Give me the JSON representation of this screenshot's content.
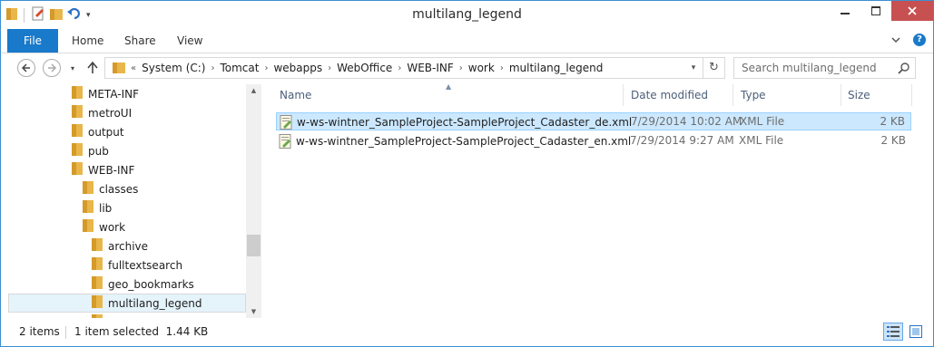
{
  "window": {
    "title": "multilang_legend"
  },
  "ribbon": {
    "tabs": [
      {
        "label": "File"
      },
      {
        "label": "Home"
      },
      {
        "label": "Share"
      },
      {
        "label": "View"
      }
    ]
  },
  "address": {
    "overflow": "«",
    "crumbs": [
      "System (C:)",
      "Tomcat",
      "webapps",
      "WebOffice",
      "WEB-INF",
      "work",
      "multilang_legend"
    ]
  },
  "search": {
    "placeholder": "Search multilang_legend"
  },
  "navpane": {
    "items": [
      {
        "label": "META-INF"
      },
      {
        "label": "metroUI"
      },
      {
        "label": "output"
      },
      {
        "label": "pub"
      },
      {
        "label": "WEB-INF"
      },
      {
        "label": "classes"
      },
      {
        "label": "lib"
      },
      {
        "label": "work"
      },
      {
        "label": "archive"
      },
      {
        "label": "fulltextsearch"
      },
      {
        "label": "geo_bookmarks"
      },
      {
        "label": "multilang_legend"
      }
    ]
  },
  "filelist": {
    "columns": {
      "name": "Name",
      "date": "Date modified",
      "type": "Type",
      "size": "Size"
    },
    "rows": [
      {
        "name": "w-ws-wintner_SampleProject-SampleProject_Cadaster_de.xml",
        "date": "7/29/2014 10:02 AM",
        "type": "XML File",
        "size": "2 KB",
        "selected": true
      },
      {
        "name": "w-ws-wintner_SampleProject-SampleProject_Cadaster_en.xml",
        "date": "7/29/2014 9:27 AM",
        "type": "XML File",
        "size": "2 KB",
        "selected": false
      }
    ]
  },
  "status": {
    "items": "2 items",
    "selected": "1 item selected  1.44 KB"
  },
  "colors": {
    "accent": "#1979ca",
    "close": "#c75050",
    "selection": "#cce8ff",
    "folder": "#e8b64a"
  }
}
